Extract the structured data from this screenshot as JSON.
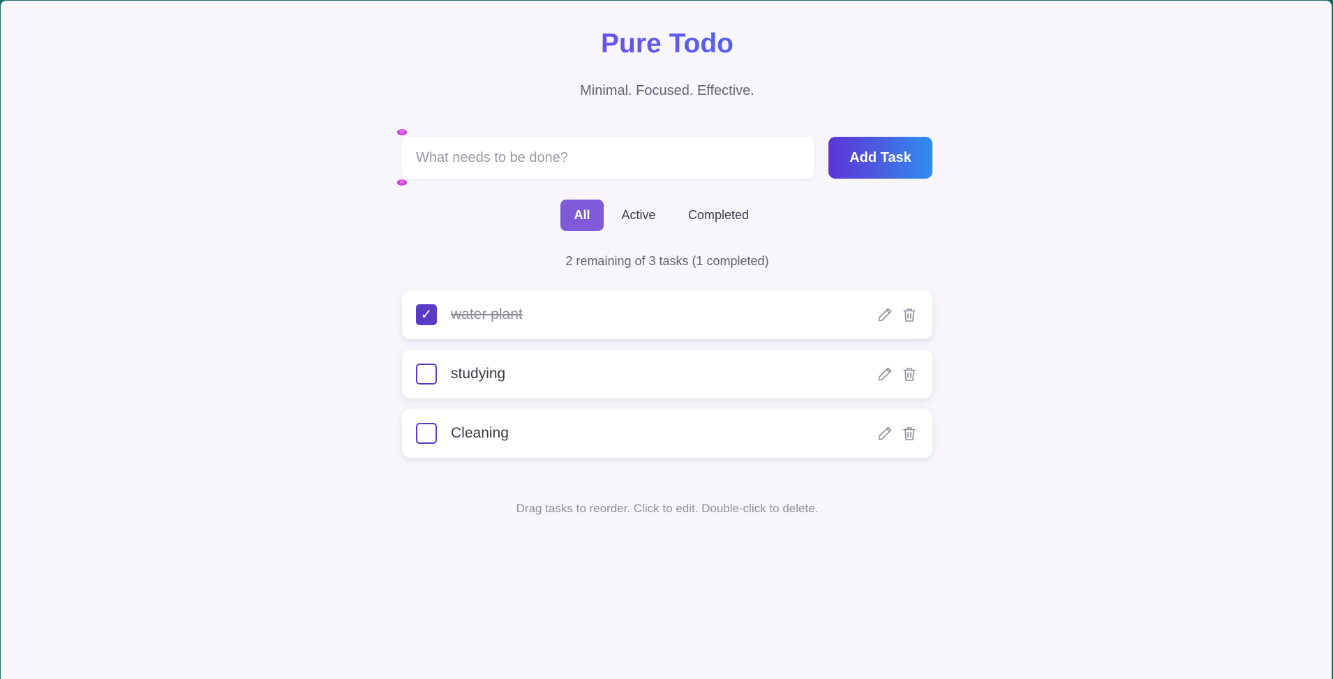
{
  "header": {
    "title": "Pure Todo",
    "subtitle": "Minimal. Focused. Effective."
  },
  "input": {
    "placeholder": "What needs to be done?",
    "value": ""
  },
  "add_button": {
    "label": "Add Task"
  },
  "filters": {
    "all": "All",
    "active": "Active",
    "completed": "Completed",
    "selected": "All"
  },
  "counter": "2 remaining of 3 tasks (1 completed)",
  "tasks": [
    {
      "text": "water plant",
      "completed": true,
      "check_glyph": "✓"
    },
    {
      "text": "studying",
      "completed": false,
      "check_glyph": ""
    },
    {
      "text": "Cleaning",
      "completed": false,
      "check_glyph": ""
    }
  ],
  "icons": {
    "edit": "pencil-icon",
    "delete": "trash-icon"
  },
  "hint": "Drag tasks to reorder. Click to edit. Double-click to delete.",
  "colors": {
    "accent": "#5a3bc6",
    "filter_active": "#7e5ad8",
    "gradient_start": "#8a3fe6",
    "gradient_end": "#3a7de8"
  }
}
